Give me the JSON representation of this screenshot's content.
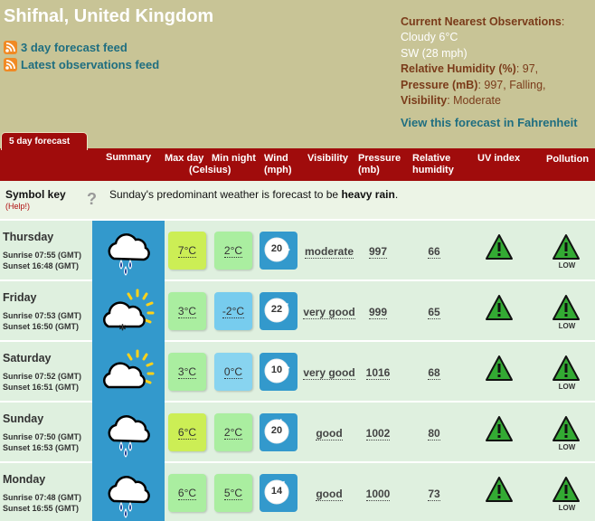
{
  "header": {
    "location": "Shifnal, United Kingdom",
    "feed_3day": "3 day forecast feed",
    "feed_latest": "Latest observations feed",
    "fahrenheit_link": "View this forecast in Fahrenheit"
  },
  "observations": {
    "title": "Current Nearest Observations",
    "weather": "Cloudy 6°C",
    "wind": "SW (28 mph)",
    "humidity_label": "Relative Humidity (%)",
    "humidity_value": ": 97,",
    "pressure_label": "Pressure (mB)",
    "pressure_value": ": 997, Falling,",
    "visibility_label": "Visibility",
    "visibility_value": ": Moderate"
  },
  "tab": {
    "label": "5 day forecast"
  },
  "columns": {
    "summary": "Summary",
    "max_day": "Max day",
    "celsius": "(Celsius)",
    "min_night": "Min night",
    "wind": "Wind",
    "mph": "(mph)",
    "visibility": "Visibility",
    "pressure": "Pressure",
    "mb": "(mb)",
    "relative": "Relative",
    "humidity": "humidity",
    "uv": "UV index",
    "pollution": "Pollution"
  },
  "symbol_key": {
    "label": "Symbol key",
    "help": "(Help!)",
    "question": "?",
    "sentence_prefix": "Sunday's predominant weather is forecast to be ",
    "sentence_bold": "heavy rain",
    "sentence_suffix": "."
  },
  "days": [
    {
      "day": "Thursday",
      "sunrise": "Sunrise 07:55 (GMT)",
      "sunset": "Sunset 16:48 (GMT)",
      "symbol": "heavy-rain-icon",
      "max": "7°C",
      "max_color": "#ccee55",
      "min": "2°C",
      "min_color": "#aaeea0",
      "wind": "20",
      "wind_dir_deg": 90,
      "visibility": "moderate",
      "pressure": "997",
      "humidity": "66",
      "pollution": "LOW"
    },
    {
      "day": "Friday",
      "sunrise": "Sunrise 07:53 (GMT)",
      "sunset": "Sunset 16:50 (GMT)",
      "symbol": "sunny-intervals-snow-icon",
      "max": "3°C",
      "max_color": "#aaeea0",
      "min": "-2°C",
      "min_color": "#77ccee",
      "wind": "22",
      "wind_dir_deg": 60,
      "visibility": "very good",
      "pressure": "999",
      "humidity": "65",
      "pollution": "LOW"
    },
    {
      "day": "Saturday",
      "sunrise": "Sunrise 07:52 (GMT)",
      "sunset": "Sunset 16:51 (GMT)",
      "symbol": "sunny-intervals-icon",
      "max": "3°C",
      "max_color": "#aaeea0",
      "min": "0°C",
      "min_color": "#88d4f0",
      "wind": "10",
      "wind_dir_deg": 75,
      "visibility": "very good",
      "pressure": "1016",
      "humidity": "68",
      "pollution": "LOW"
    },
    {
      "day": "Sunday",
      "sunrise": "Sunrise 07:50 (GMT)",
      "sunset": "Sunset 16:53 (GMT)",
      "symbol": "heavy-rain-icon",
      "max": "6°C",
      "max_color": "#ccee55",
      "min": "2°C",
      "min_color": "#aaeea0",
      "wind": "20",
      "wind_dir_deg": 20,
      "visibility": "good",
      "pressure": "1002",
      "humidity": "80",
      "pollution": "LOW"
    },
    {
      "day": "Monday",
      "sunrise": "Sunrise 07:48 (GMT)",
      "sunset": "Sunset 16:55 (GMT)",
      "symbol": "heavy-rain-icon",
      "max": "6°C",
      "max_color": "#aaeea0",
      "min": "5°C",
      "min_color": "#aaeea0",
      "wind": "14",
      "wind_dir_deg": 35,
      "visibility": "good",
      "pressure": "1000",
      "humidity": "73",
      "pollution": "LOW"
    }
  ],
  "colors": {
    "header_bg": "#c8c496",
    "bar_red": "#a00c0c",
    "link_teal": "#1f6e80",
    "symbol_blue": "#3399cc",
    "uv_green": "#33aa33"
  }
}
